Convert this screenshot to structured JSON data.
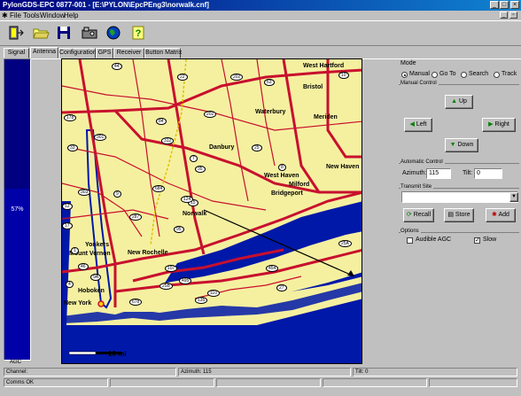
{
  "window": {
    "title": "PylonGDS-EPC 0877-001 - [E:\\PYLON\\EpcPEng3\\norwalk.cnf]"
  },
  "menu": {
    "system_icon": "✱",
    "items": [
      "File",
      "Tools",
      "Window",
      "Help"
    ]
  },
  "tabs": {
    "side": "Signal",
    "items": [
      "Antenna",
      "Configuration",
      "GPS",
      "Receiver",
      "Button Matrix"
    ],
    "selected": "Antenna"
  },
  "signal": {
    "percent_label": "57%",
    "level": 0.57,
    "bottom_label": "AGC"
  },
  "map": {
    "scale_label": "10 mi",
    "cities": [
      {
        "name": "West Hartford"
      },
      {
        "name": "Bristol"
      },
      {
        "name": "Waterbury"
      },
      {
        "name": "Meriden"
      },
      {
        "name": "Danbury"
      },
      {
        "name": "West Haven"
      },
      {
        "name": "New Haven"
      },
      {
        "name": "Milford"
      },
      {
        "name": "Bridgeport"
      },
      {
        "name": "Norwalk"
      },
      {
        "name": "Yonkers"
      },
      {
        "name": "Mount Vernon"
      },
      {
        "name": "New Rochelle"
      },
      {
        "name": "Hoboken"
      },
      {
        "name": "New York"
      }
    ],
    "shields": [
      "44",
      "22",
      "202",
      "63",
      "10",
      "178",
      "301",
      "84",
      "202",
      "33",
      "312",
      "7",
      "35",
      "25",
      "8",
      "15",
      "684",
      "124",
      "303",
      "9",
      "287",
      "12",
      "95",
      "17",
      "1",
      "25A",
      "9A",
      "107",
      "454",
      "27",
      "495",
      "25B",
      "110",
      "135",
      "678",
      "46",
      "4"
    ]
  },
  "mode": {
    "label": "Mode",
    "options": [
      "Manual",
      "Go To",
      "Search",
      "Track"
    ],
    "selected": "Manual"
  },
  "manual_control": {
    "label": "Manual Control",
    "up": "Up",
    "left": "Left",
    "right": "Right",
    "down": "Down"
  },
  "automatic_control": {
    "label": "Automatic Control",
    "azimuth_label": "Azimuth:",
    "azimuth_value": "115",
    "tilt_label": "Tilt:",
    "tilt_value": "0"
  },
  "transmit_site": {
    "label": "Transmit Site",
    "value": "",
    "recall": "Recall",
    "store": "Store",
    "add": "Add"
  },
  "options": {
    "label": "Options",
    "audible_agc": "Audible AGC",
    "audible_agc_checked": false,
    "slow": "Slow",
    "slow_checked": true
  },
  "status": {
    "channel": "Channel:",
    "azimuth": "Azimuth: 115",
    "tilt": "Tilt: 0",
    "comms": "Comms OK"
  },
  "colors": {
    "title_bar": "#000080",
    "water": "#0018a8",
    "land": "#f5f0a0",
    "roads": "#c8102e"
  }
}
